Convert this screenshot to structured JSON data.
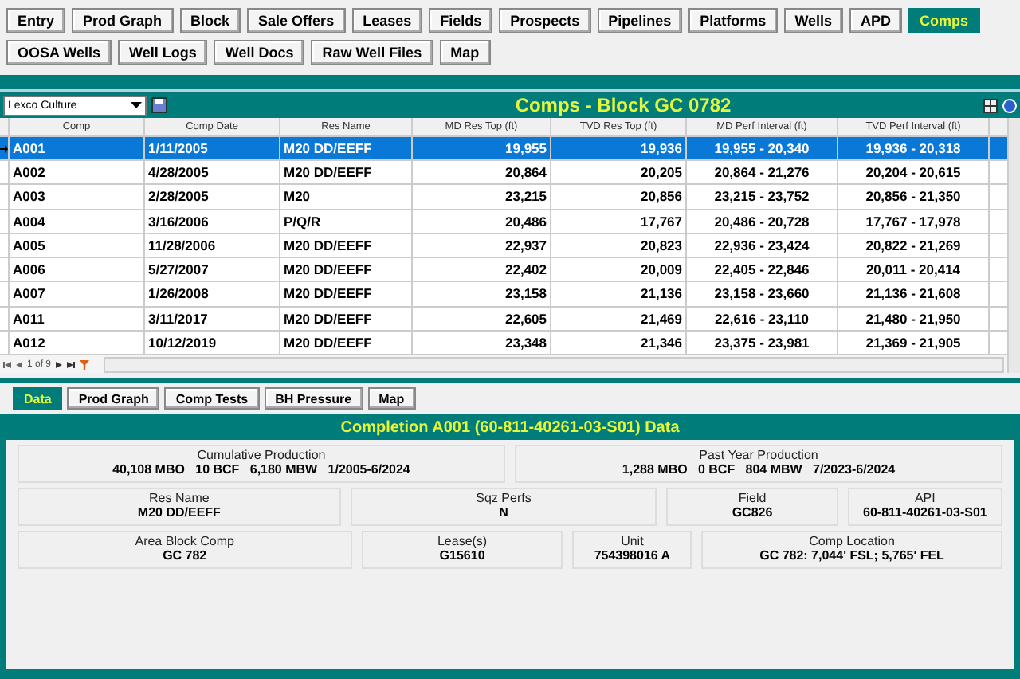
{
  "nav_tabs": [
    {
      "label": "Entry",
      "selected": false
    },
    {
      "label": "Prod Graph",
      "selected": false
    },
    {
      "label": "Block",
      "selected": false
    },
    {
      "label": "Sale Offers",
      "selected": false
    },
    {
      "label": "Leases",
      "selected": false
    },
    {
      "label": "Fields",
      "selected": false
    },
    {
      "label": "Prospects",
      "selected": false
    },
    {
      "label": "Pipelines",
      "selected": false
    },
    {
      "label": "Platforms",
      "selected": false
    },
    {
      "label": "Wells",
      "selected": false
    },
    {
      "label": "APD",
      "selected": false
    },
    {
      "label": "Comps",
      "selected": true
    },
    {
      "label": "OOSA Wells",
      "selected": false
    },
    {
      "label": "Well Logs",
      "selected": false
    },
    {
      "label": "Well Docs",
      "selected": false
    },
    {
      "label": "Raw Well Files",
      "selected": false
    },
    {
      "label": "Map",
      "selected": false
    }
  ],
  "culture_select": {
    "value": "Lexco Culture"
  },
  "grid": {
    "title": "Comps - Block GC 0782",
    "columns": [
      {
        "label": "Comp"
      },
      {
        "label": "Comp Date"
      },
      {
        "label": "Res Name"
      },
      {
        "label": "MD Res Top (ft)"
      },
      {
        "label": "TVD Res Top (ft)"
      },
      {
        "label": "MD Perf Interval (ft)"
      },
      {
        "label": "TVD Perf Interval (ft)"
      }
    ],
    "rows": [
      {
        "selected": true,
        "cells": [
          "A001",
          "1/11/2005",
          "M20 DD/EEFF",
          "19,955",
          "19,936",
          "19,955 - 20,340",
          "19,936 - 20,318"
        ]
      },
      {
        "selected": false,
        "cells": [
          "A002",
          "4/28/2005",
          "M20 DD/EEFF",
          "20,864",
          "20,205",
          "20,864 - 21,276",
          "20,204 - 20,615"
        ]
      },
      {
        "selected": false,
        "cells": [
          "A003",
          "2/28/2005",
          "M20",
          "23,215",
          "20,856",
          "23,215 - 23,752",
          "20,856 - 21,350"
        ]
      },
      {
        "selected": false,
        "cells": [
          "A004",
          "3/16/2006",
          "P/Q/R",
          "20,486",
          "17,767",
          "20,486 - 20,728",
          "17,767 - 17,978"
        ]
      },
      {
        "selected": false,
        "cells": [
          "A005",
          "11/28/2006",
          "M20 DD/EEFF",
          "22,937",
          "20,823",
          "22,936 - 23,424",
          "20,822 - 21,269"
        ]
      },
      {
        "selected": false,
        "cells": [
          "A006",
          "5/27/2007",
          "M20 DD/EEFF",
          "22,402",
          "20,009",
          "22,405 - 22,846",
          "20,011 - 20,414"
        ]
      },
      {
        "selected": false,
        "cells": [
          "A007",
          "1/26/2008",
          "M20 DD/EEFF",
          "23,158",
          "21,136",
          "23,158 - 23,660",
          "21,136 - 21,608"
        ]
      },
      {
        "selected": false,
        "cells": [
          "A011",
          "3/11/2017",
          "M20 DD/EEFF",
          "22,605",
          "21,469",
          "22,616 - 23,110",
          "21,480 - 21,950"
        ]
      },
      {
        "selected": false,
        "cells": [
          "A012",
          "10/12/2019",
          "M20 DD/EEFF",
          "23,348",
          "21,346",
          "23,375 - 23,981",
          "21,369 - 21,905"
        ]
      }
    ],
    "pager": "1 of 9"
  },
  "detail_tabs": [
    {
      "label": "Data",
      "selected": true
    },
    {
      "label": "Prod Graph",
      "selected": false
    },
    {
      "label": "Comp Tests",
      "selected": false
    },
    {
      "label": "BH Pressure",
      "selected": false
    },
    {
      "label": "Map",
      "selected": false
    }
  ],
  "detail": {
    "title": "Completion A001 (60-811-40261-03-S01) Data",
    "field_rows": [
      [
        {
          "label": "Cumulative Production",
          "value": "40,108 MBO   10 BCF   6,180 MBW   1/2005-6/2024"
        },
        {
          "label": "Past Year Production",
          "value": "1,288 MBO   0 BCF   804 MBW   7/2023-6/2024"
        }
      ],
      [
        {
          "label": "Res Name",
          "value": "M20 DD/EEFF"
        },
        {
          "label": "Sqz Perfs",
          "value": "N"
        },
        {
          "label": "Field",
          "value": "GC826"
        },
        {
          "label": "API",
          "value": "60-811-40261-03-S01"
        }
      ],
      [
        {
          "label": "Area Block Comp",
          "value": "GC 782"
        },
        {
          "label": "Lease(s)",
          "value": "G15610"
        },
        {
          "label": "Unit",
          "value": "754398016 A"
        },
        {
          "label": "Comp Location",
          "value": "GC 782: 7,044' FSL; 5,765' FEL"
        }
      ]
    ]
  }
}
